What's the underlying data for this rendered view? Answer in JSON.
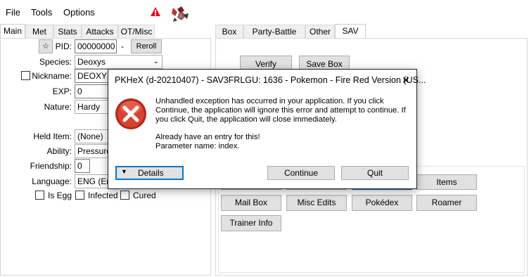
{
  "menu": {
    "file": "File",
    "tools": "Tools",
    "options": "Options"
  },
  "left_tabs": [
    "Main",
    "Met",
    "Stats",
    "Attacks",
    "OT/Misc"
  ],
  "right_tabs": [
    "Box",
    "Party-Battle Box",
    "Other",
    "SAV"
  ],
  "main": {
    "pid_label": "PID:",
    "pid_value": "00000000",
    "pid_dash": "-",
    "reroll": "Reroll",
    "species_label": "Species:",
    "species_value": "Deoxys",
    "nickname_label": "Nickname:",
    "nickname_value": "DEOXYS",
    "exp_label": "EXP:",
    "exp_value": "0",
    "nature_label": "Nature:",
    "nature_value": "Hardy",
    "held_item_label": "Held Item:",
    "held_item_value": "(None)",
    "ability_label": "Ability:",
    "ability_value": "Pressure",
    "friendship_label": "Friendship:",
    "friendship_value": "0",
    "language_label": "Language:",
    "language_value": "ENG (Eng",
    "is_egg": "Is Egg",
    "infected": "Infected",
    "cured": "Cured"
  },
  "sav": {
    "verify": "Verify",
    "save_box": "Save Box",
    "items": "Items",
    "mail_box": "Mail Box",
    "misc_edits": "Misc Edits",
    "pokedex": "Pokédex",
    "roamer": "Roamer",
    "trainer_info": "Trainer Info"
  },
  "dialog": {
    "title": "PKHeX (d-20210407) - SAV3FRLGU: 1636 - Pokemon - Fire Red Version (US...",
    "msg1": "Unhandled exception has occurred in your application. If you click",
    "msg2": "Continue, the application will ignore this error and attempt to continue. If",
    "msg3": "you click Quit, the application will close immediately.",
    "msg4": "Already have an entry for this!",
    "msg5": "Parameter name: index.",
    "details": "Details",
    "continue": "Continue",
    "quit": "Quit",
    "close": "✕"
  },
  "colors": {
    "error_red": "#c42b1c",
    "focus_blue": "#0078d7"
  }
}
